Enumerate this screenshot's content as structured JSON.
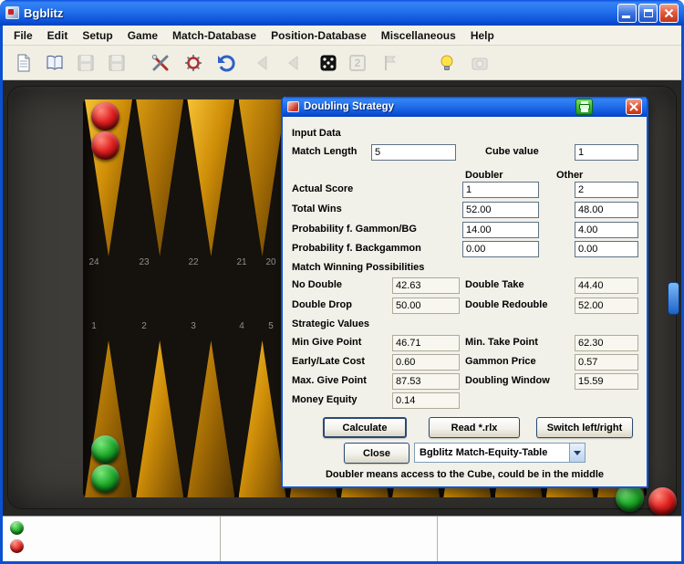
{
  "window": {
    "title": "Bgblitz"
  },
  "menu": {
    "items": [
      "File",
      "Edit",
      "Setup",
      "Game",
      "Match-Database",
      "Position-Database",
      "Miscellaneous",
      "Help"
    ]
  },
  "toolbar": {
    "cube_label": "2"
  },
  "board": {
    "top_numbers": [
      "24",
      "23",
      "22",
      "21",
      "20"
    ],
    "bottom_numbers": [
      "1",
      "2",
      "3",
      "4",
      "5"
    ]
  },
  "colors": {
    "titlebar_blue": "#0a50d8",
    "board_gold": "#cf8e08",
    "checker_red": "#e02020",
    "checker_green": "#1faa2a"
  },
  "dialog": {
    "title": "Doubling Strategy",
    "headers": {
      "input_data": "Input Data",
      "doubler": "Doubler",
      "other": "Other",
      "mwp": "Match Winning Possibilities",
      "strategic": "Strategic Values"
    },
    "match_length": {
      "label": "Match Length",
      "value": "5"
    },
    "cube_value": {
      "label": "Cube value",
      "value": "1"
    },
    "input_rows": [
      {
        "label": "Actual Score",
        "doubler": "1",
        "other": "2"
      },
      {
        "label": "Total Wins",
        "doubler": "52.00",
        "other": "48.00"
      },
      {
        "label": "Probability f. Gammon/BG",
        "doubler": "14.00",
        "other": "4.00"
      },
      {
        "label": "Probability f. Backgammon",
        "doubler": "0.00",
        "other": "0.00"
      }
    ],
    "mwp_rows": [
      {
        "label_a": "No Double",
        "value_a": "42.63",
        "label_b": "Double Take",
        "value_b": "44.40"
      },
      {
        "label_a": "Double Drop",
        "value_a": "50.00",
        "label_b": "Double Redouble",
        "value_b": "52.00"
      }
    ],
    "strategic_rows": [
      {
        "label_a": "Min Give Point",
        "value_a": "46.71",
        "label_b": "Min. Take Point",
        "value_b": "62.30"
      },
      {
        "label_a": "Early/Late Cost",
        "value_a": "0.60",
        "label_b": "Gammon Price",
        "value_b": "0.57"
      },
      {
        "label_a": "Max. Give Point",
        "value_a": "87.53",
        "label_b": "Doubling Window",
        "value_b": "15.59"
      }
    ],
    "money_equity": {
      "label": "Money Equity",
      "value": "0.14"
    },
    "buttons": {
      "calculate": "Calculate",
      "read_rlx": "Read *.rlx",
      "switch": "Switch left/right",
      "close": "Close"
    },
    "equity_table": {
      "value": "Bgblitz Match-Equity-Table"
    },
    "footer": "Doubler means access to the Cube, could be in the middle"
  }
}
